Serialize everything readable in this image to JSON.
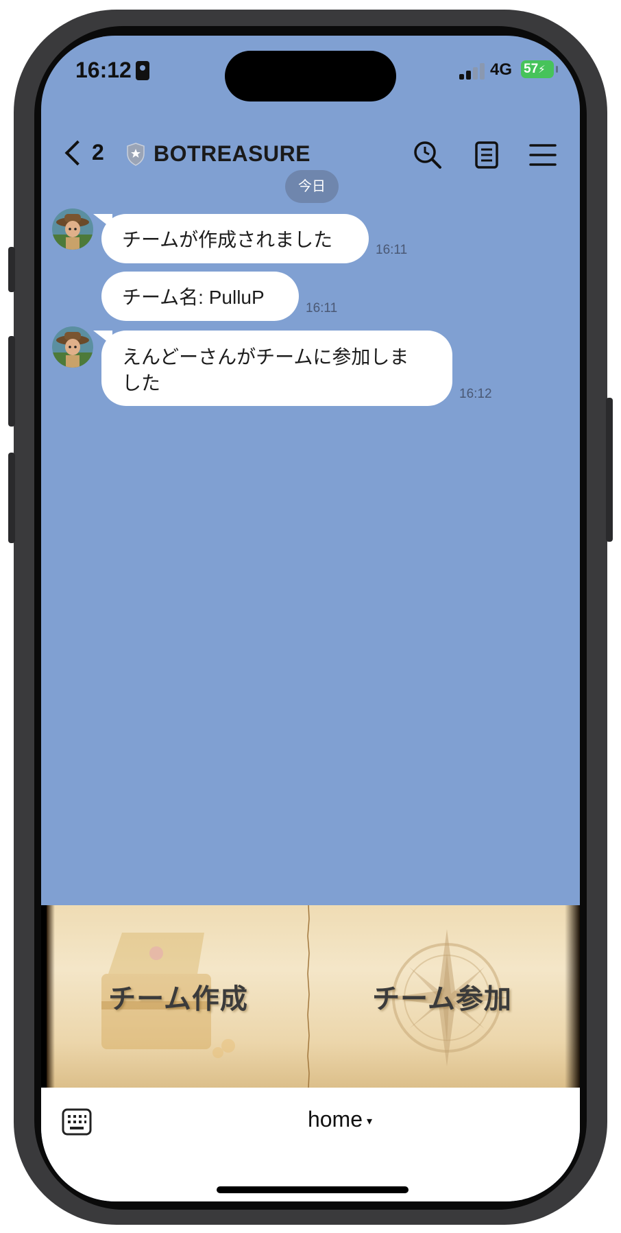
{
  "status_bar": {
    "time": "16:12",
    "network": "4G",
    "battery": "57"
  },
  "header": {
    "back_count": "2",
    "title": "BOTREASURE",
    "icons": [
      "search-icon",
      "notes-icon",
      "menu-icon"
    ]
  },
  "chat": {
    "date_label": "今日",
    "messages": [
      {
        "text": "チームが作成されました",
        "time": "16:11"
      },
      {
        "text": "チーム名: PulluP",
        "time": "16:11"
      },
      {
        "text": "えんどーさんがチームに参加しま した",
        "time": "16:12"
      }
    ]
  },
  "rich_menu": {
    "left_label": "チーム作成",
    "right_label": "チーム参加"
  },
  "bottom_bar": {
    "toggle_label": "home",
    "toggle_arrow": "▾"
  },
  "colors": {
    "chat_background": "#80a0d2",
    "bubble": "#ffffff",
    "battery": "#46c35a",
    "parchment": "#efdcb4"
  }
}
